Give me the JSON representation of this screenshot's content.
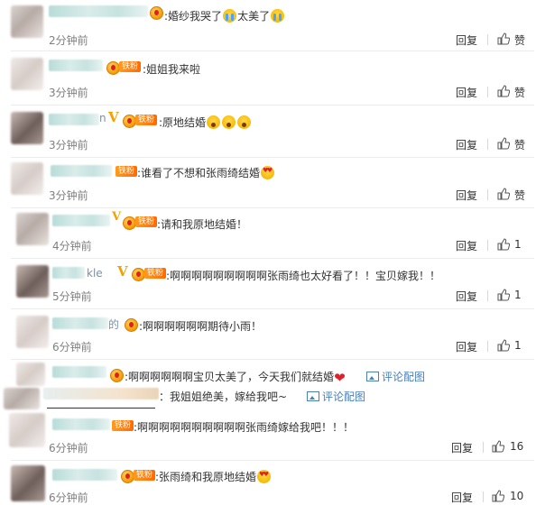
{
  "ui": {
    "reply_label": "回复",
    "like_label": "赞",
    "fan_badge": "铁粉",
    "colon": ":",
    "pic_link": "评论配图"
  },
  "comments": [
    {
      "text": "婚纱我哭了",
      "tail": "太美了",
      "time": "2分钟前",
      "likes": "赞"
    },
    {
      "text": "姐姐我来啦",
      "time": "3分钟前",
      "likes": "赞"
    },
    {
      "name_suffix": "n",
      "text": "原地结婚",
      "time": "3分钟前",
      "likes": "赞"
    },
    {
      "text": "谁看了不想和张雨绮结婚",
      "time": "3分钟前",
      "likes": "赞"
    },
    {
      "text": "请和我原地结婚！",
      "time": "4分钟前",
      "likes": "1"
    },
    {
      "name_suffix": "kle",
      "text": "啊啊啊啊啊啊啊啊啊张雨绮也太好看了！！宝贝嫁我！！",
      "time": "5分钟前",
      "likes": "1"
    },
    {
      "name_suffix": "的",
      "text": "啊啊啊啊啊啊期待小雨！",
      "time": "6分钟前",
      "likes": "1"
    },
    {
      "text": "啊啊啊啊啊啊宝贝太美了，今天我们就结婚",
      "sub_text": "：我姐姐绝美，嫁给我吧~"
    },
    {
      "text": "啊啊啊啊啊啊啊啊啊啊张雨绮嫁给我吧！！！",
      "time": "6分钟前",
      "likes": "16"
    },
    {
      "text": "张雨绮和我原地结婚",
      "time": "6分钟前",
      "likes": "10"
    }
  ]
}
